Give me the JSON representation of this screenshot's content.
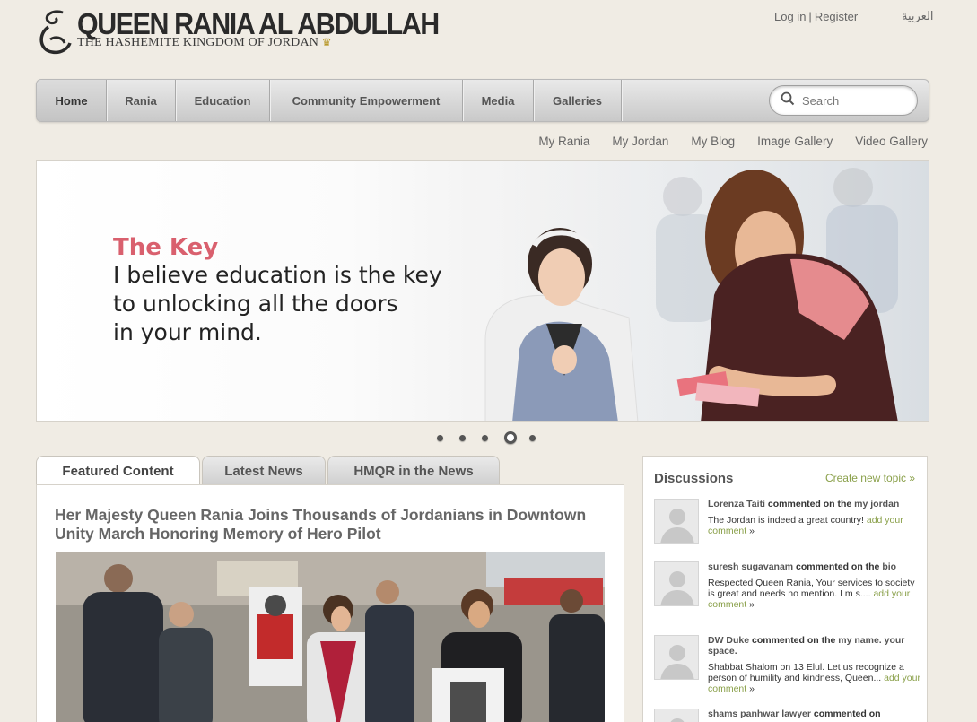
{
  "header": {
    "title": "QUEEN RANIA AL ABDULLAH",
    "subtitle": "THE HASHEMITE KINGDOM OF JORDAN",
    "login": "Log in",
    "separator": "|",
    "register": "Register",
    "arabic": "العربية"
  },
  "nav": {
    "items": [
      {
        "label": "Home"
      },
      {
        "label": "Rania"
      },
      {
        "label": "Education"
      },
      {
        "label": "Community Empowerment"
      },
      {
        "label": "Media"
      },
      {
        "label": "Galleries"
      }
    ],
    "search_placeholder": "Search"
  },
  "subnav": [
    "My Rania",
    "My Jordan",
    "My Blog",
    "Image Gallery",
    "Video Gallery"
  ],
  "hero": {
    "heading": "The Key",
    "quote_line1": "I believe education is the key",
    "quote_line2": "to unlocking all the doors",
    "quote_line3": "in your mind.",
    "slide_count": 5,
    "active_slide": 4
  },
  "tabs": [
    {
      "label": "Featured Content"
    },
    {
      "label": "Latest News"
    },
    {
      "label": "HMQR in the News"
    }
  ],
  "article": {
    "title": "Her Majesty Queen Rania Joins Thousands of Jordanians in Downtown Unity March Honoring Memory of Hero Pilot"
  },
  "discussions": {
    "title": "Discussions",
    "create": "Create new topic »",
    "items": [
      {
        "user": "Lorenza Taiti",
        "action": " commented on the ",
        "topic": "my jordan",
        "text": "The Jordan is indeed a great country! ",
        "link": "add your comment",
        "arrow": " »"
      },
      {
        "user": "suresh sugavanam",
        "action": " commented on the ",
        "topic": "bio",
        "text": "Respected Queen Rania, Your services to society is great and needs no mention. I m s.... ",
        "link": "add your comment",
        "arrow": " »"
      },
      {
        "user": "DW Duke",
        "action": " commented on the ",
        "topic": "my name. your space.",
        "text": "Shabbat Shalom on 13 Elul. Let us recognize a person of humility and kindness, Queen... ",
        "link": "add your comment",
        "arrow": " »"
      },
      {
        "user": "shams panhwar lawyer",
        "action": " commented on ",
        "topic": "",
        "text": "",
        "link": "",
        "arrow": ""
      }
    ]
  },
  "colors": {
    "background": "#f0ece4",
    "accent_green": "#8aa04a",
    "hero_heading": "#d9606e"
  }
}
